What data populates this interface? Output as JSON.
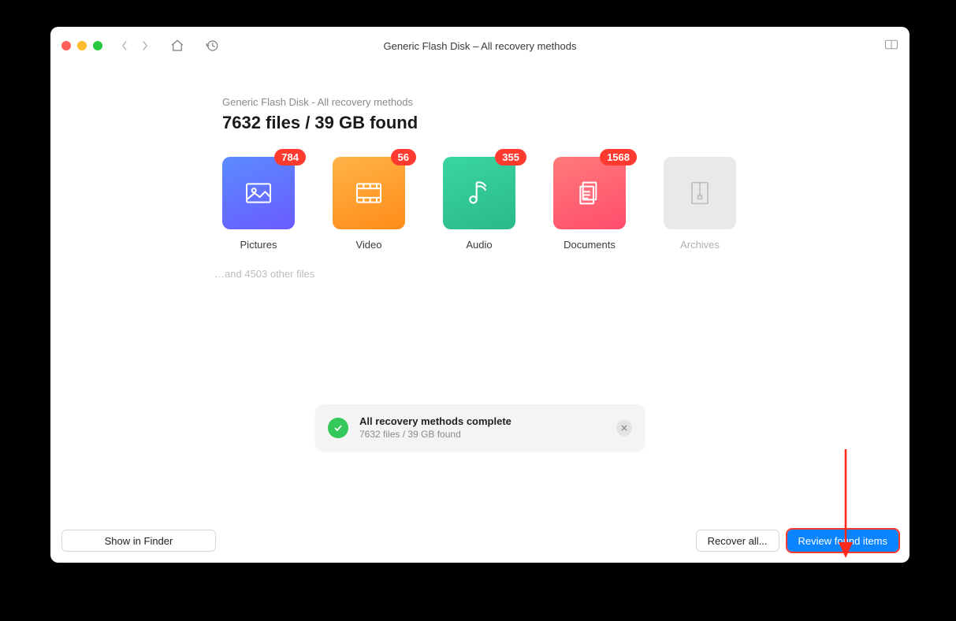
{
  "window": {
    "title": "Generic Flash Disk – All recovery methods"
  },
  "header": {
    "subtitle": "Generic Flash Disk - All recovery methods",
    "headline": "7632 files / 39 GB found"
  },
  "categories": [
    {
      "key": "pictures",
      "label": "Pictures",
      "count": "784",
      "disabled": false
    },
    {
      "key": "video",
      "label": "Video",
      "count": "56",
      "disabled": false
    },
    {
      "key": "audio",
      "label": "Audio",
      "count": "355",
      "disabled": false
    },
    {
      "key": "documents",
      "label": "Documents",
      "count": "1568",
      "disabled": false
    },
    {
      "key": "archives",
      "label": "Archives",
      "count": null,
      "disabled": true
    }
  ],
  "other_files_text": "…and 4503 other files",
  "toast": {
    "title": "All recovery methods complete",
    "subtitle": "7632 files / 39 GB found"
  },
  "footer": {
    "show_in_finder": "Show in Finder",
    "recover_all": "Recover all...",
    "review_found": "Review found items"
  }
}
